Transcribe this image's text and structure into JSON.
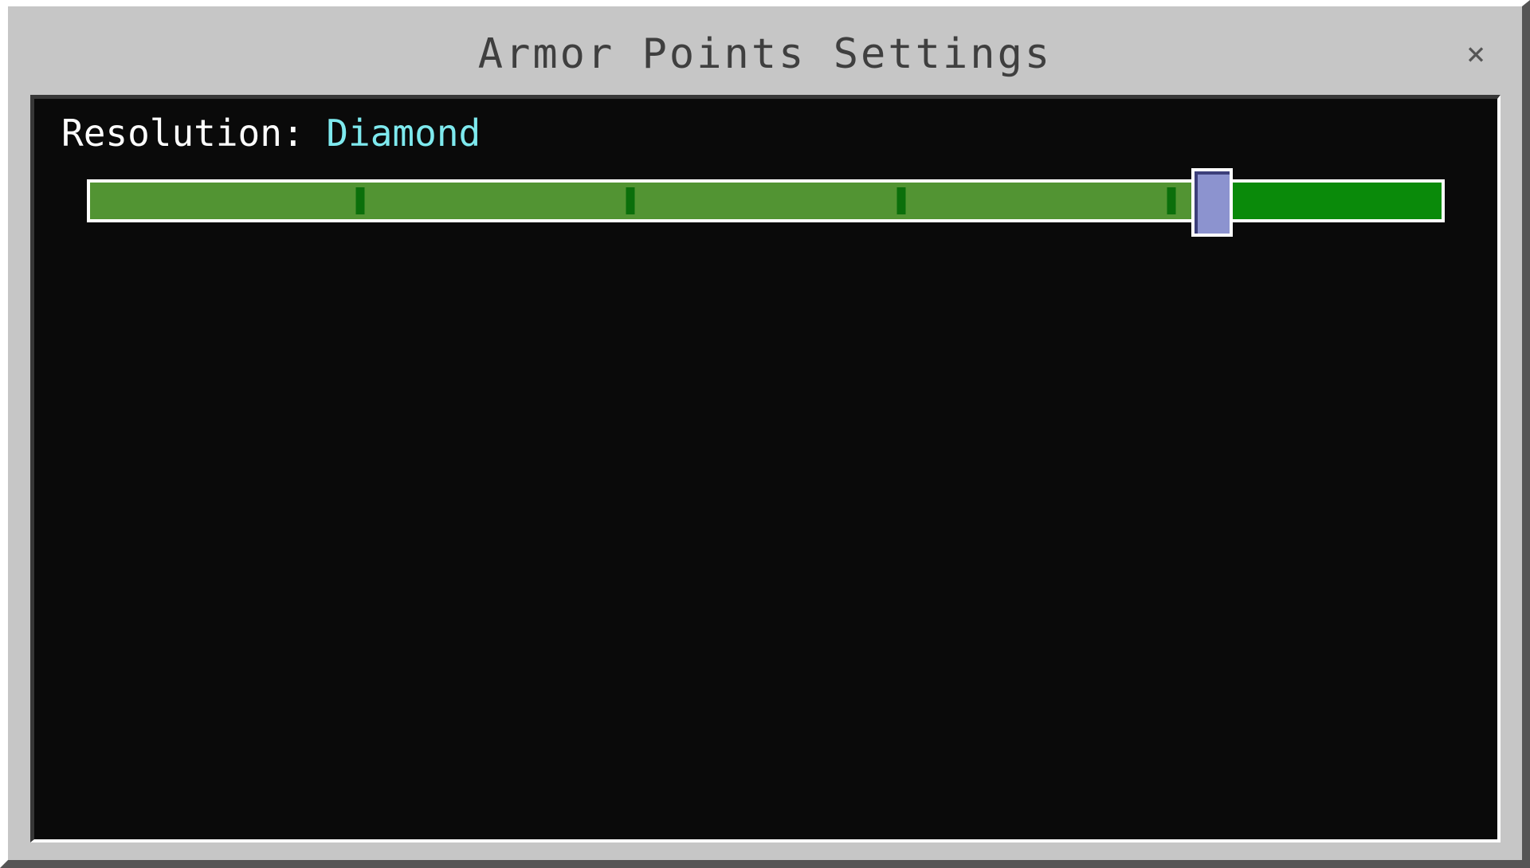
{
  "window": {
    "title": "Armor Points Settings",
    "close_label": "×"
  },
  "setting": {
    "label": "Resolution:",
    "value": "Diamond"
  },
  "slider": {
    "steps": 5,
    "value_fraction": 0.83,
    "colors": {
      "track_filled": "#529433",
      "track_empty": "#0a8a0a",
      "tick": "#0b6f0b",
      "thumb": "#8c93cf",
      "border": "#ffffff"
    }
  },
  "colors": {
    "value_text": "#7ee9ee",
    "content_bg": "#0a0a0a",
    "frame_bg": "#c6c6c6"
  }
}
